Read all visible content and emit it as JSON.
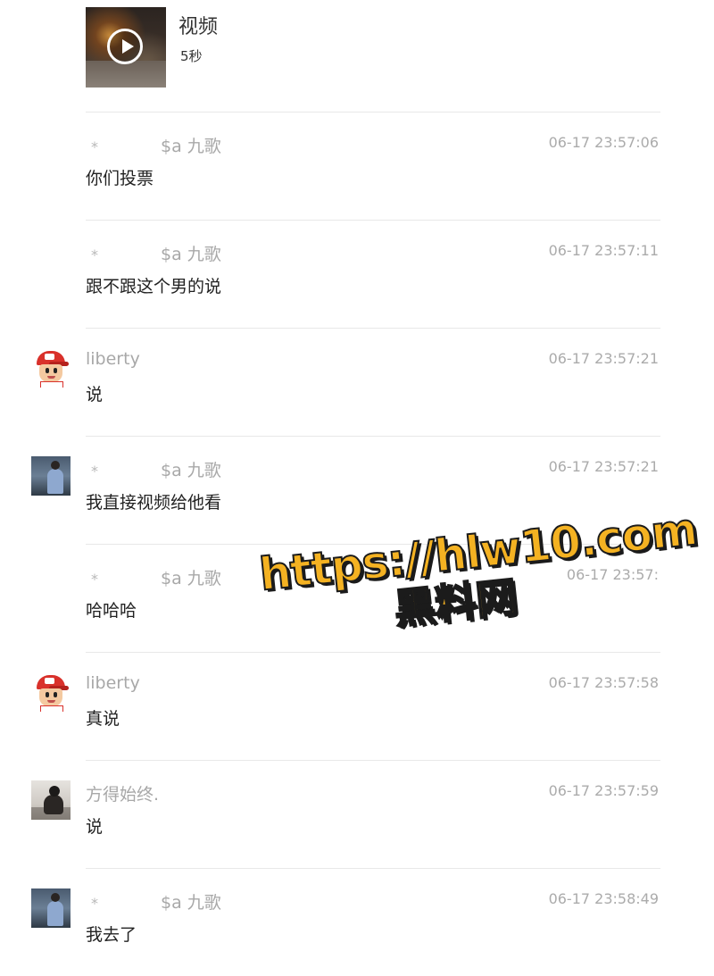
{
  "video": {
    "title": "视频",
    "duration": "5秒",
    "play_icon": "play-circle-icon"
  },
  "messages": [
    {
      "avatar": "",
      "star": "*",
      "name": "$a 九歌",
      "time": "06-17 23:57:06",
      "text": "你们投票"
    },
    {
      "avatar": "",
      "star": "*",
      "name": "$a 九歌",
      "time": "06-17 23:57:11",
      "text": "跟不跟这个男的说"
    },
    {
      "avatar": "cartoon-boy-avatar",
      "star": "",
      "name": "liberty",
      "time": "06-17 23:57:21",
      "text": "说"
    },
    {
      "avatar": "photo-blue-avatar",
      "star": "*",
      "name": "$a 九歌",
      "time": "06-17 23:57:21",
      "text": "我直接视频给他看"
    },
    {
      "avatar": "",
      "star": "*",
      "name": "$a 九歌",
      "time": "06-17 23:57:",
      "text": "哈哈哈"
    },
    {
      "avatar": "cartoon-boy-avatar",
      "star": "",
      "name": "liberty",
      "time": "06-17 23:57:58",
      "text": "真说"
    },
    {
      "avatar": "photo-gray-avatar",
      "star": "",
      "name": "方得始终.",
      "time": "06-17 23:57:59",
      "text": "说"
    },
    {
      "avatar": "photo-blue-avatar",
      "star": "*",
      "name": "$a 九歌",
      "time": "06-17 23:58:49",
      "text": "我去了"
    }
  ],
  "watermark": {
    "url": "https://hlw10.com",
    "name": "黑料网"
  }
}
